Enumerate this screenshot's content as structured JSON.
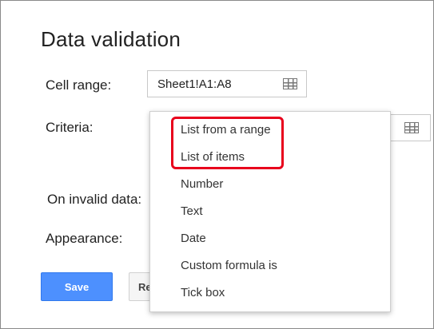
{
  "dialog": {
    "title": "Data validation",
    "cell_range": {
      "label": "Cell range:",
      "value": "Sheet1!A1:A8",
      "icon": "grid-icon"
    },
    "criteria": {
      "label": "Criteria:",
      "icon": "grid-icon"
    },
    "on_invalid_data": {
      "label": "On invalid data:"
    },
    "appearance": {
      "label": "Appearance:"
    },
    "buttons": {
      "save": "Save",
      "remove_partial": "Re"
    }
  },
  "criteria_dropdown": {
    "items": [
      "List from a range",
      "List of items",
      "Number",
      "Text",
      "Date",
      "Custom formula is",
      "Tick box"
    ],
    "highlighted_items": [
      "List from a range",
      "List of items"
    ]
  },
  "colors": {
    "primary_button": "#4d90fe",
    "highlight_border": "#e8001c"
  }
}
